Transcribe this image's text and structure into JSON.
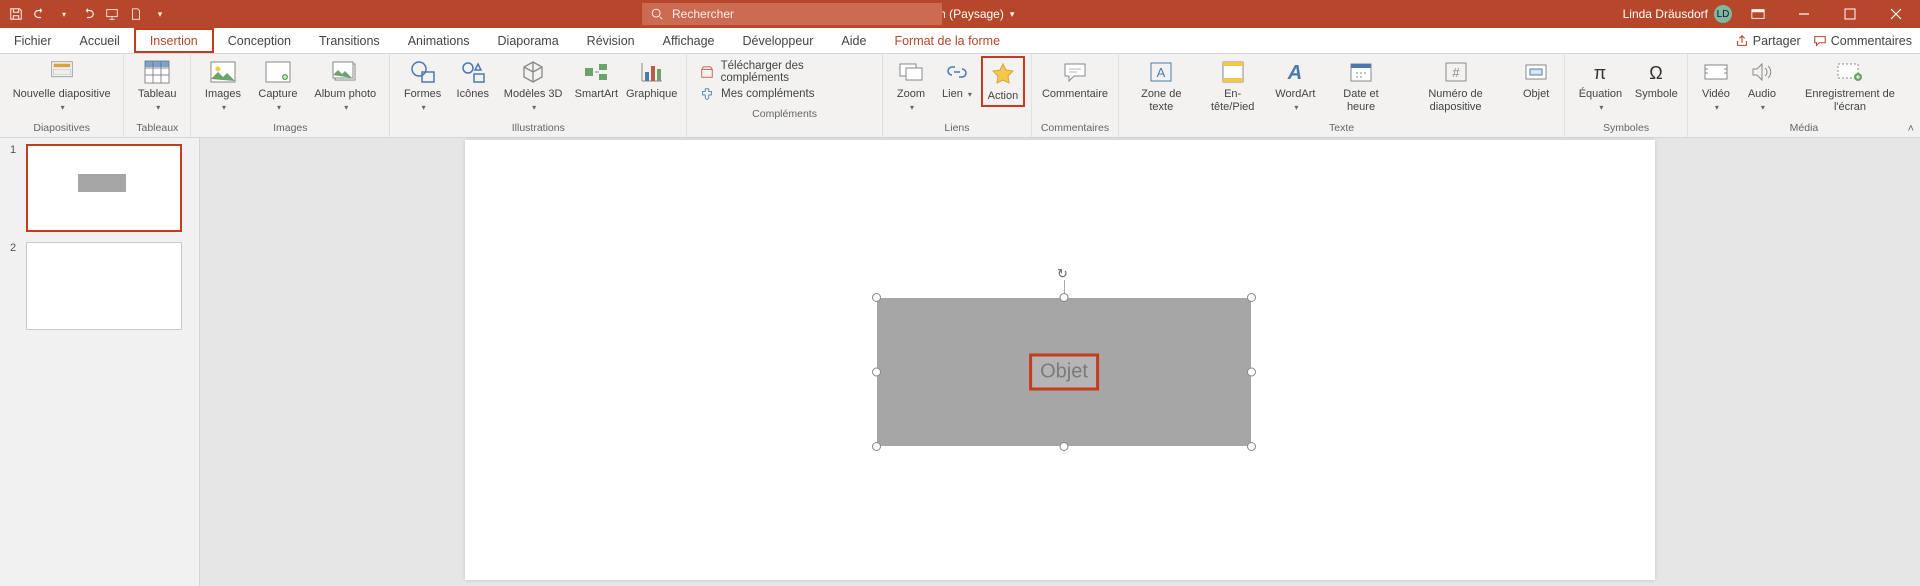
{
  "titlebar": {
    "doc_title": "Présentation (Paysage)",
    "search_placeholder": "Rechercher",
    "user_name": "Linda Dräusdorf",
    "user_initials": "LD"
  },
  "tabs": {
    "fichier": "Fichier",
    "accueil": "Accueil",
    "insertion": "Insertion",
    "conception": "Conception",
    "transitions": "Transitions",
    "animations": "Animations",
    "diaporama": "Diaporama",
    "revision": "Révision",
    "affichage": "Affichage",
    "developpeur": "Développeur",
    "aide": "Aide",
    "format_forme": "Format de la forme",
    "partager": "Partager",
    "commentaires": "Commentaires"
  },
  "ribbon": {
    "nouvelle_diapo": "Nouvelle diapositive",
    "tableau": "Tableau",
    "images": "Images",
    "capture": "Capture",
    "album_photo": "Album photo",
    "formes": "Formes",
    "icones": "Icônes",
    "modeles_3d": "Modèles 3D",
    "smartart": "SmartArt",
    "graphique": "Graphique",
    "telecharger_compl": "Télécharger des compléments",
    "mes_compl": "Mes compléments",
    "zoom": "Zoom",
    "lien": "Lien",
    "action": "Action",
    "commentaire": "Commentaire",
    "zone_texte": "Zone de texte",
    "entete_pied": "En-tête/Pied",
    "wordart": "WordArt",
    "date_heure": "Date et heure",
    "numero_diapo": "Numéro de diapositive",
    "objet": "Objet",
    "equation": "Équation",
    "symbole": "Symbole",
    "video": "Vidéo",
    "audio": "Audio",
    "enregistrement_ecran": "Enregistrement de l'écran",
    "grp_diapositives": "Diapositives",
    "grp_tableaux": "Tableaux",
    "grp_images": "Images",
    "grp_illustrations": "Illustrations",
    "grp_complements": "Compléments",
    "grp_liens": "Liens",
    "grp_commentaires": "Commentaires",
    "grp_texte": "Texte",
    "grp_symboles": "Symboles",
    "grp_media": "Média"
  },
  "slide": {
    "num1": "1",
    "num2": "2",
    "object_label": "Objet"
  }
}
